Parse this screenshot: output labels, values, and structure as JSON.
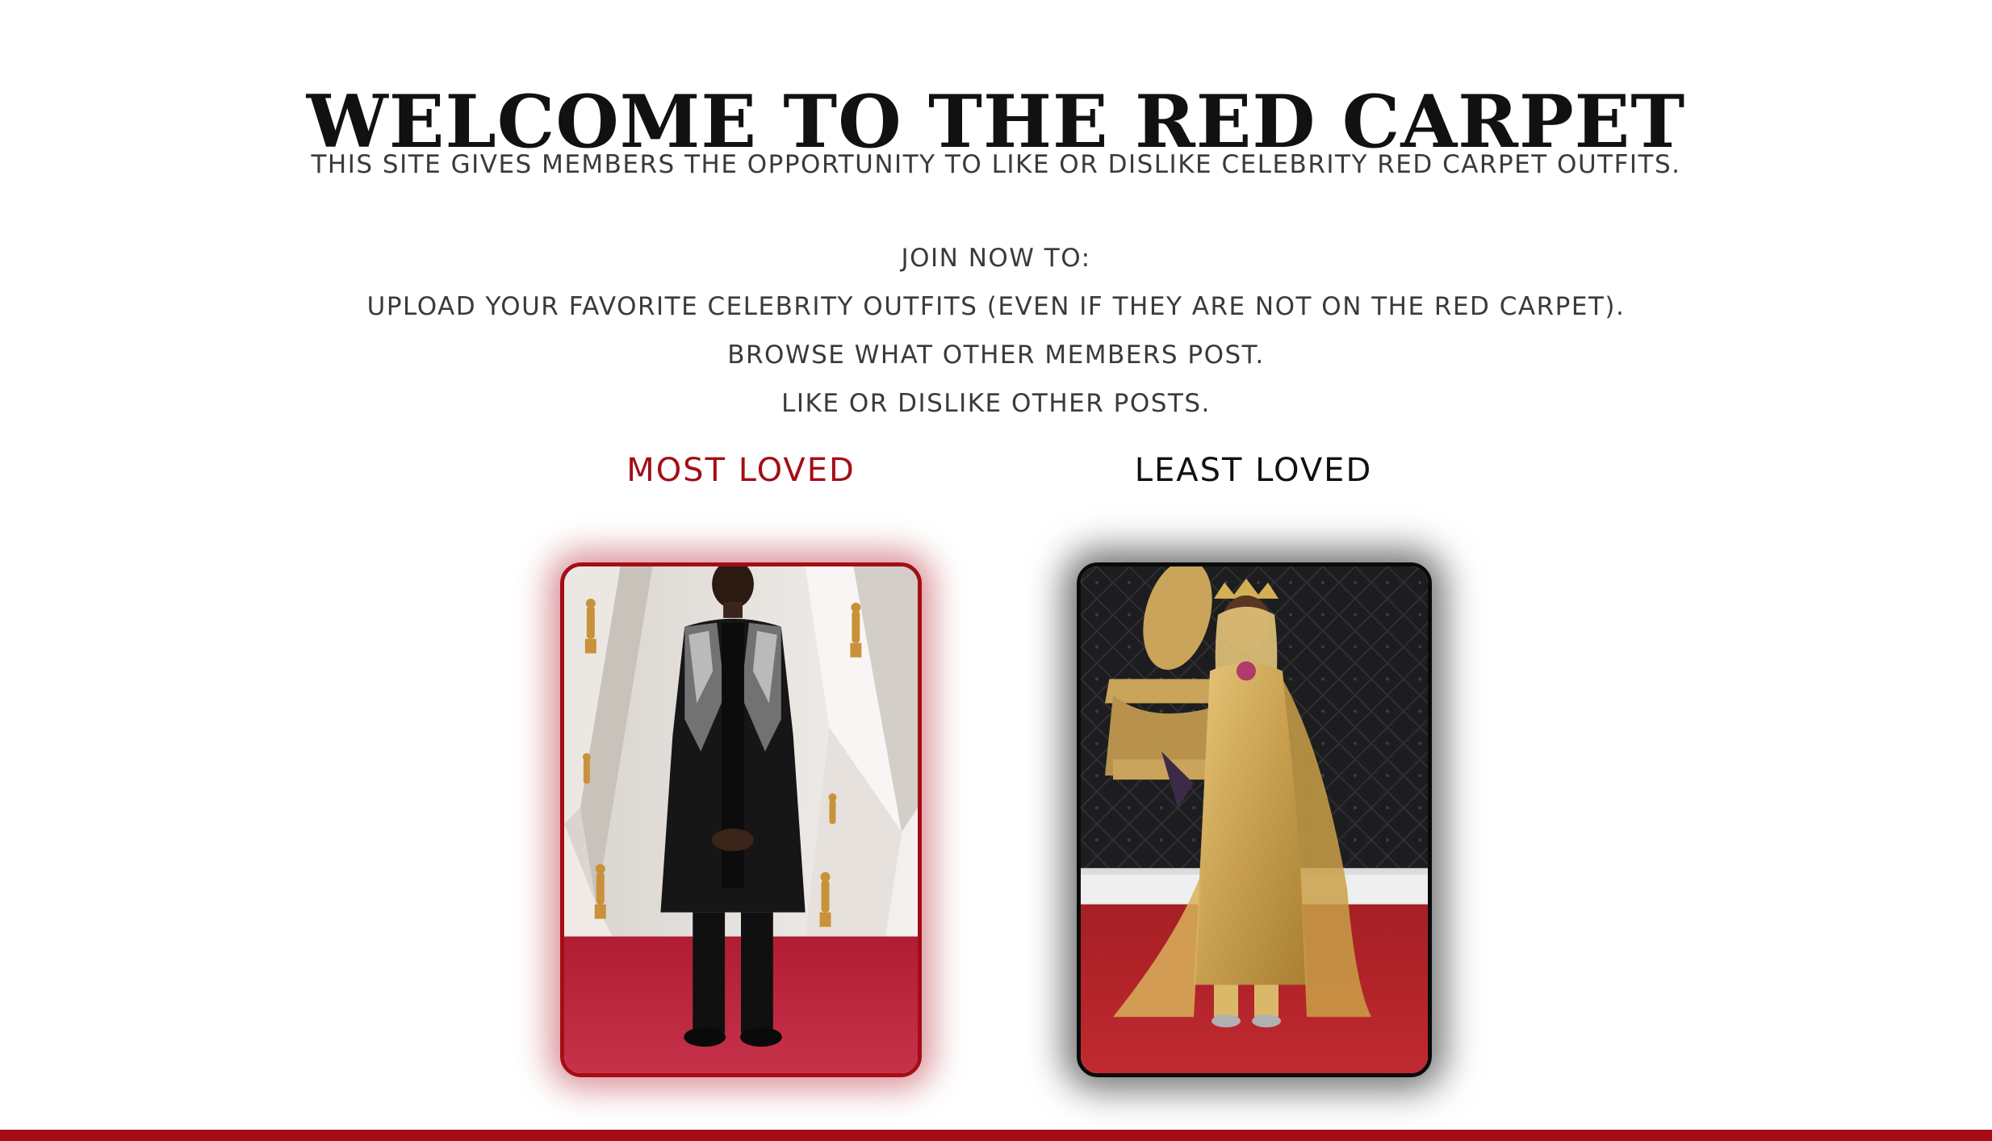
{
  "page": {
    "title": "WELCOME TO THE RED CARPET",
    "intro": "THIS SITE GIVES MEMBERS THE OPPORTUNITY TO LIKE OR DISLIKE CELEBRITY RED CARPET OUTFITS.",
    "join": {
      "heading": "JOIN NOW TO:",
      "items": [
        "UPLOAD YOUR FAVORITE CELEBRITY OUTFITS (EVEN IF THEY ARE NOT ON THE RED CARPET).",
        "BROWSE WHAT OTHER MEMBERS POST.",
        "LIKE OR DISLIKE OTHER POSTS."
      ]
    }
  },
  "columns": {
    "most_loved": {
      "heading": "MOST LOVED"
    },
    "least_loved": {
      "heading": "LEAST LOVED"
    }
  },
  "colors": {
    "accent": "#a50d16",
    "text": "#3a3a3a",
    "least_border": "#0a0a0a"
  }
}
